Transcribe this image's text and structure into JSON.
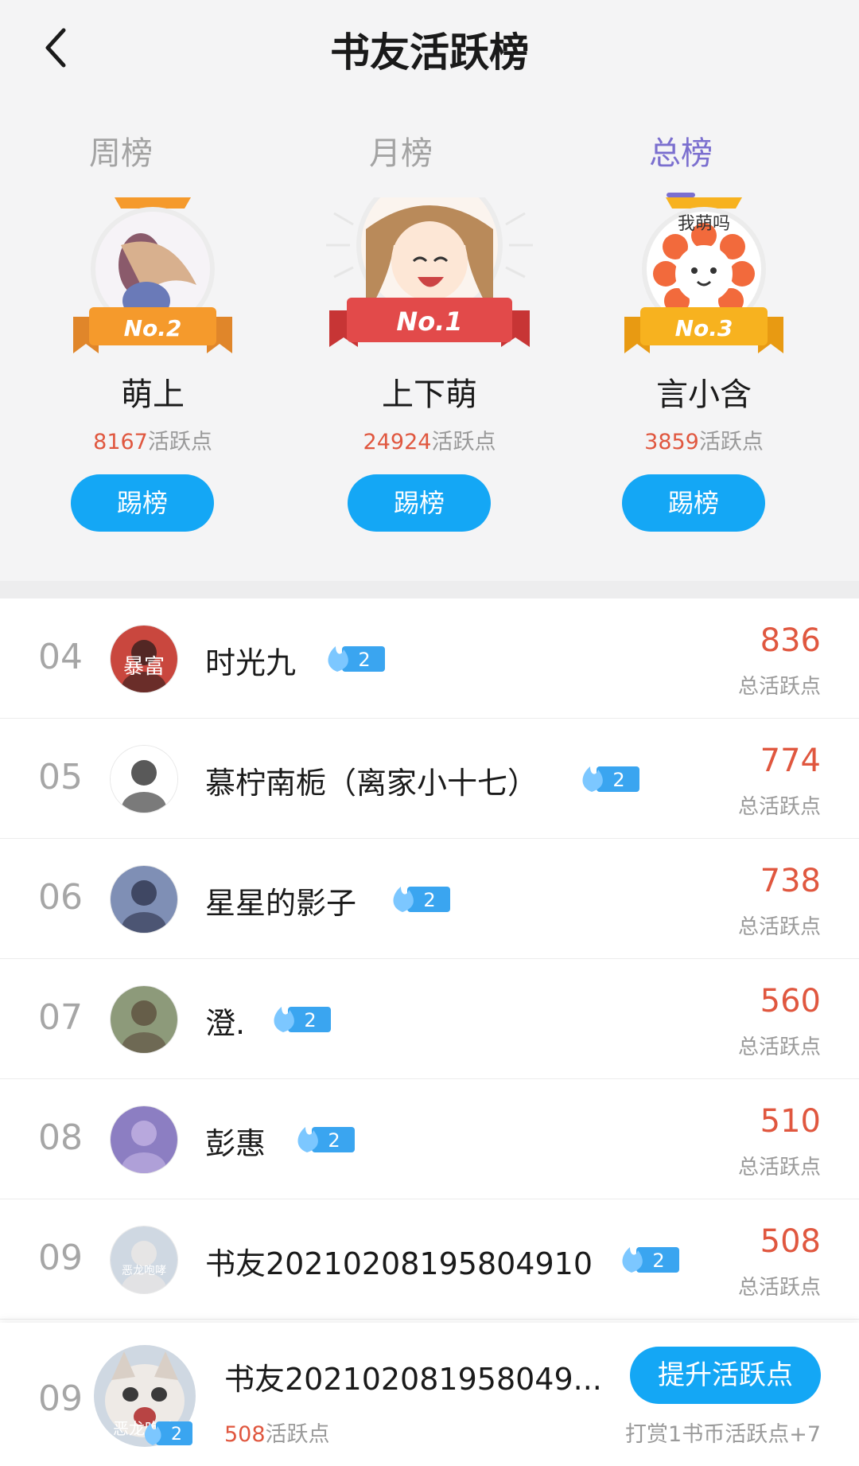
{
  "header": {
    "title": "书友活跃榜",
    "back_icon": "back-arrow-icon"
  },
  "tabs": [
    {
      "label": "周榜",
      "active": false
    },
    {
      "label": "月榜",
      "active": false
    },
    {
      "label": "总榜",
      "active": true
    }
  ],
  "podium": [
    {
      "badge": "No.2",
      "name": "萌上",
      "points": "8167",
      "points_suffix": "活跃点",
      "button": "踢榜",
      "banner_color": "#f59a2c"
    },
    {
      "badge": "No.1",
      "name": "上下萌",
      "points": "24924",
      "points_suffix": "活跃点",
      "button": "踢榜",
      "banner_color": "#e24a4a"
    },
    {
      "badge": "No.3",
      "name": "言小含",
      "points": "3859",
      "points_suffix": "活跃点",
      "button": "踢榜",
      "banner_color": "#f7b21f"
    }
  ],
  "ranking": [
    {
      "rank": "04",
      "name": "时光九",
      "level": "2",
      "score": "836",
      "score_label": "总活跃点",
      "avatar_text": "暴富"
    },
    {
      "rank": "05",
      "name": "慕柠南栀（离家小十七）",
      "level": "2",
      "score": "774",
      "score_label": "总活跃点",
      "avatar_text": ""
    },
    {
      "rank": "06",
      "name": "星星的影子",
      "level": "2",
      "score": "738",
      "score_label": "总活跃点",
      "avatar_text": ""
    },
    {
      "rank": "07",
      "name": "澄.",
      "level": "2",
      "score": "560",
      "score_label": "总活跃点",
      "avatar_text": ""
    },
    {
      "rank": "08",
      "name": "彭惠",
      "level": "2",
      "score": "510",
      "score_label": "总活跃点",
      "avatar_text": ""
    },
    {
      "rank": "09",
      "name": "书友20210208195804910",
      "level": "2",
      "score": "508",
      "score_label": "总活跃点",
      "avatar_text": "恶龙咆哮"
    }
  ],
  "me": {
    "rank": "09",
    "name": "书友202102081958049...",
    "points": "508",
    "points_suffix": "活跃点",
    "level": "2",
    "button": "提升活跃点",
    "hint": "打赏1书币活跃点+7",
    "avatar_text": "恶龙咆哮"
  },
  "colors": {
    "accent": "#7b6fcf",
    "button": "#14a7f5",
    "score": "#e0573f"
  }
}
